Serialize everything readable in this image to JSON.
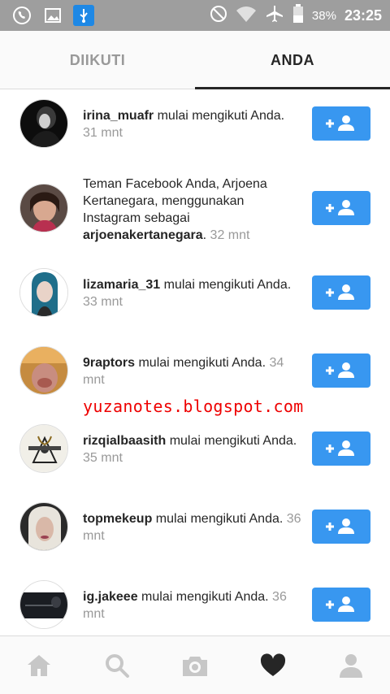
{
  "status_bar": {
    "battery_percent": "38%",
    "time": "23:25",
    "left_icons": [
      "whatsapp-icon",
      "gallery-icon",
      "usb-icon"
    ],
    "right_icons": [
      "do-not-disturb-icon",
      "wifi-icon",
      "airplane-icon",
      "battery-icon"
    ]
  },
  "tabs": [
    {
      "label": "DIIKUTI",
      "active": false
    },
    {
      "label": "ANDA",
      "active": true
    }
  ],
  "notifications": [
    {
      "pre": "",
      "username": "irina_muafr",
      "text": " mulai mengikuti Anda.",
      "time": "31 mnt"
    },
    {
      "pre": "Teman Facebook Anda, Arjoena Kertanegara, menggunakan Instagram sebagai ",
      "username": "arjoenakertanegara",
      "text": ".",
      "time": "32 mnt"
    },
    {
      "pre": "",
      "username": "lizamaria_31",
      "text": " mulai mengikuti Anda.",
      "time": "33 mnt"
    },
    {
      "pre": "",
      "username": "9raptors",
      "text": " mulai mengikuti Anda.",
      "time": "34 mnt"
    },
    {
      "pre": "",
      "username": "rizqialbaasith",
      "text": " mulai mengikuti Anda.",
      "time": "35 mnt"
    },
    {
      "pre": "",
      "username": "topmekeup",
      "text": " mulai mengikuti Anda.",
      "time": "36 mnt"
    },
    {
      "pre": "",
      "username": "ig.jakeee",
      "text": " mulai mengikuti Anda.",
      "time": "36 mnt"
    }
  ],
  "watermark": "yuzanotes.blogspot.com",
  "colors": {
    "accent": "#3897f0",
    "status_bar": "#9e9e9e",
    "watermark": "#e00000"
  },
  "bottom_nav": [
    "home-icon",
    "search-icon",
    "camera-icon",
    "heart-icon",
    "profile-icon"
  ]
}
